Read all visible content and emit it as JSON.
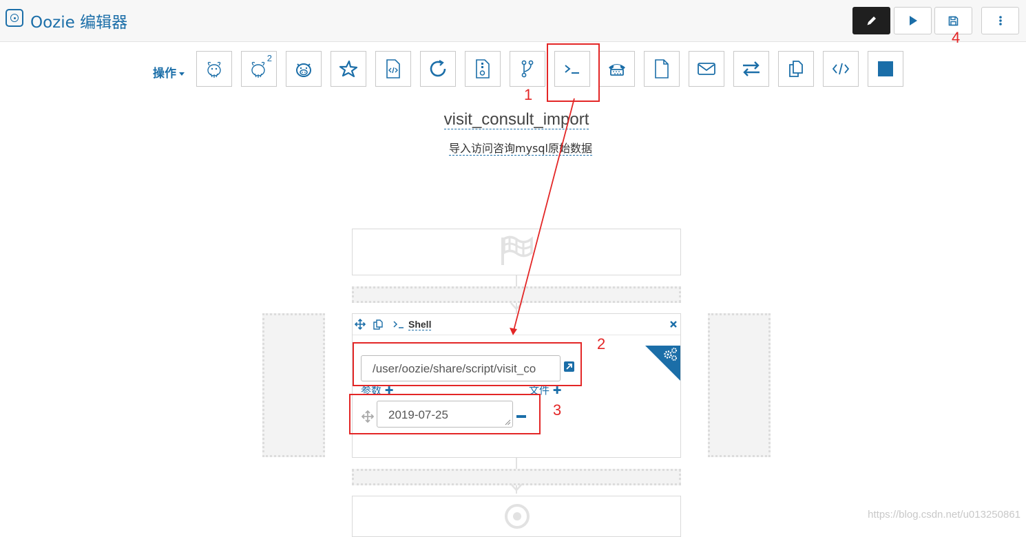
{
  "header": {
    "title": "Oozie 编辑器",
    "logo_icon": "oozie-logo-icon",
    "buttons": [
      {
        "name": "edit-button",
        "icon": "pencil-icon"
      },
      {
        "name": "run-button",
        "icon": "play-icon"
      },
      {
        "name": "save-button",
        "icon": "floppy-disk-icon"
      },
      {
        "name": "more-button",
        "icon": "vertical-dots-icon"
      }
    ]
  },
  "toolbar": {
    "actions_label": "操作",
    "hive_version_badge": "2",
    "tools": [
      "hive-icon",
      "hive2-icon",
      "pig-icon",
      "spark-icon",
      "java-icon",
      "subworkflow-icon",
      "sqoop-icon",
      "fork-icon",
      "shell-icon",
      "ssh-icon",
      "fs-icon",
      "email-icon",
      "distcp-icon",
      "copy-icon",
      "generic-code-icon",
      "stop-icon"
    ]
  },
  "workflow": {
    "name": "visit_consult_import",
    "description": "导入访问咨询mysql原始数据"
  },
  "shell_node": {
    "title": "Shell",
    "script_path": "/user/oozie/share/script/visit_co",
    "params_label": "参数",
    "files_label": "文件",
    "argument_value": "2019-07-25"
  },
  "annotations": [
    "1",
    "2",
    "3",
    "4"
  ],
  "watermark": "https://blog.csdn.net/u013250861",
  "colors": {
    "accent": "#1b6ea8",
    "highlight_red": "#e32626",
    "edit_button_bg": "#1f1f1f"
  }
}
